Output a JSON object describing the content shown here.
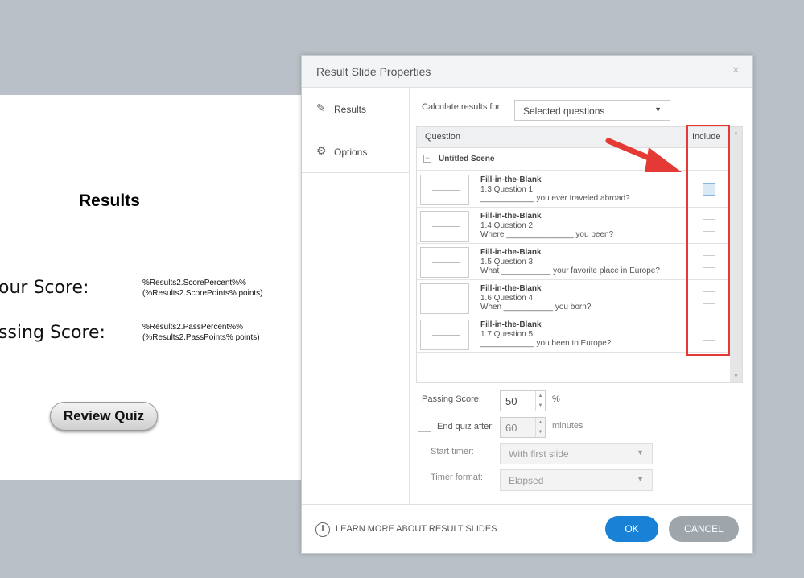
{
  "slide": {
    "title": "Results",
    "score_label": "our Score:",
    "score_var1": "%Results2.ScorePercent%%",
    "score_var2": "(%Results2.ScorePoints% points)",
    "pass_label": "ssing Score:",
    "pass_var1": "%Results2.PassPercent%%",
    "pass_var2": "(%Results2.PassPoints% points)",
    "review_button": "Review Quiz"
  },
  "dialog": {
    "title": "Result Slide Properties",
    "close": "×",
    "nav": [
      {
        "label": "Results",
        "icon": "pencil-icon"
      },
      {
        "label": "Options",
        "icon": "gear-icon"
      }
    ],
    "calc_label": "Calculate results for:",
    "calc_value": "Selected questions",
    "table": {
      "col_question": "Question",
      "col_include": "Include",
      "scene": "Untitled Scene",
      "rows": [
        {
          "type": "Fill-in-the-Blank",
          "num": "1.3 Question 1",
          "text": "____________ you ever traveled abroad?",
          "checked": false
        },
        {
          "type": "Fill-in-the-Blank",
          "num": "1.4 Question 2",
          "text": "Where _______________ you been?",
          "checked": false
        },
        {
          "type": "Fill-in-the-Blank",
          "num": "1.5 Question 3",
          "text": "What ___________ your favorite place in Europe?",
          "checked": false
        },
        {
          "type": "Fill-in-the-Blank",
          "num": "1.6 Question 4",
          "text": "When ___________ you born?",
          "checked": false
        },
        {
          "type": "Fill-in-the-Blank",
          "num": "1.7 Question 5",
          "text": "____________ you been to Europe?",
          "checked": false
        }
      ]
    },
    "passing_label": "Passing Score:",
    "passing_value": "50",
    "passing_unit": "%",
    "endquiz_label": "End quiz after:",
    "endquiz_value": "60",
    "endquiz_unit": "minutes",
    "endquiz_checked": false,
    "start_timer_label": "Start timer:",
    "start_timer_value": "With first slide",
    "timer_format_label": "Timer format:",
    "timer_format_value": "Elapsed",
    "learn_more": "LEARN MORE ABOUT RESULT SLIDES",
    "ok": "OK",
    "cancel": "CANCEL",
    "colors": {
      "ok": "#1a82d6",
      "cancel": "#9ea5ab",
      "highlight": "#e53935"
    }
  }
}
